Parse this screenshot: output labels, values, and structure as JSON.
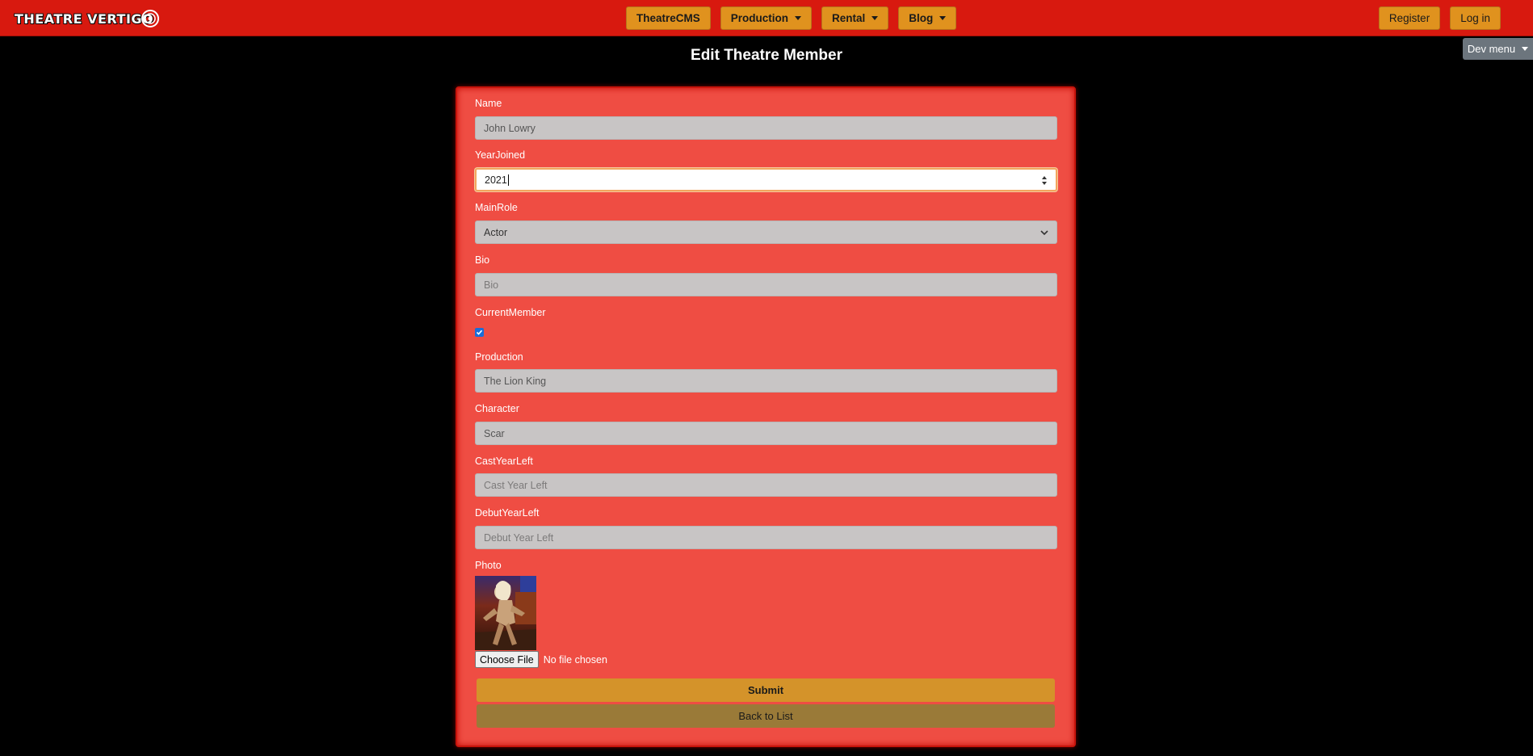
{
  "brand": {
    "logo_text": "THEATRE VERTIGO"
  },
  "nav": {
    "center": [
      {
        "label": "TheatreCMS",
        "has_dropdown": false
      },
      {
        "label": "Production",
        "has_dropdown": true
      },
      {
        "label": "Rental",
        "has_dropdown": true
      },
      {
        "label": "Blog",
        "has_dropdown": true
      }
    ],
    "register_label": "Register",
    "login_label": "Log in",
    "dev_menu_label": "Dev menu"
  },
  "page": {
    "title": "Edit Theatre Member"
  },
  "form": {
    "name": {
      "label": "Name",
      "value": "John Lowry"
    },
    "year_joined": {
      "label": "YearJoined",
      "value": "2021"
    },
    "main_role": {
      "label": "MainRole",
      "value": "Actor"
    },
    "bio": {
      "label": "Bio",
      "placeholder": "Bio"
    },
    "current_member": {
      "label": "CurrentMember",
      "checked": true
    },
    "production": {
      "label": "Production",
      "value": "The Lion King"
    },
    "character": {
      "label": "Character",
      "value": "Scar"
    },
    "cast_year_left": {
      "label": "CastYearLeft",
      "placeholder": "Cast Year Left"
    },
    "debut_year_left": {
      "label": "DebutYearLeft",
      "placeholder": "Debut Year Left"
    },
    "photo": {
      "label": "Photo",
      "choose_file_label": "Choose File",
      "no_file_text": "No file chosen"
    },
    "submit_label": "Submit",
    "back_label": "Back to List"
  },
  "colors": {
    "navbar": "#d8190f",
    "panel": "#ef4d43",
    "nav_button": "#e0921e",
    "submit": "#d4932a",
    "back": "#9a7a38",
    "dev_menu": "#6c757d"
  }
}
